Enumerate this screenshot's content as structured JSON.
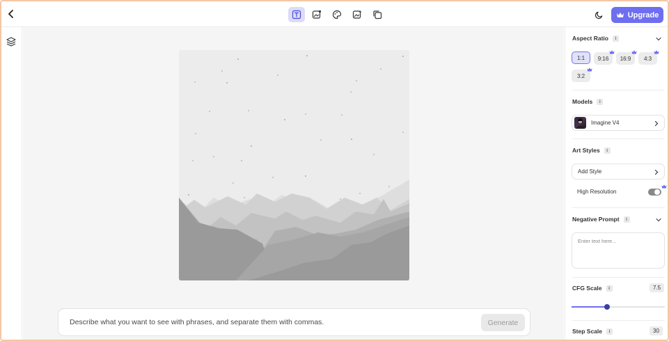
{
  "toolbar": {
    "tools": [
      {
        "icon": "text-to-image-icon",
        "active": true
      },
      {
        "icon": "image-edit-icon",
        "active": false
      },
      {
        "icon": "palette-icon",
        "active": false
      },
      {
        "icon": "image-sparkle-icon",
        "active": false
      },
      {
        "icon": "image-stack-icon",
        "active": false
      }
    ],
    "upgrade_label": "Upgrade",
    "accent_color": "#6e6ef0"
  },
  "prompt": {
    "placeholder": "Describe what you want to see with phrases, and separate them with commas.",
    "generate_label": "Generate"
  },
  "panel": {
    "aspect_ratio": {
      "title": "Aspect Ratio",
      "info": "i",
      "options": [
        {
          "label": "1:1",
          "selected": true,
          "premium": false
        },
        {
          "label": "9:16",
          "selected": false,
          "premium": true
        },
        {
          "label": "16:9",
          "selected": false,
          "premium": true
        },
        {
          "label": "4:3",
          "selected": false,
          "premium": true
        },
        {
          "label": "3:2",
          "selected": false,
          "premium": true
        }
      ]
    },
    "models": {
      "title": "Models",
      "info": "i",
      "selected": "Imagine V4"
    },
    "art_styles": {
      "title": "Art Styles",
      "info": "i",
      "add_label": "Add Style",
      "high_res_label": "High Resolution",
      "high_res_on": false,
      "high_res_premium": true
    },
    "negative_prompt": {
      "title": "Negative Prompt",
      "info": "i",
      "placeholder": "Enter text here..."
    },
    "cfg_scale": {
      "title": "CFG Scale",
      "info": "i",
      "value": "7.5",
      "fraction": 0.38
    },
    "step_scale": {
      "title": "Step Scale",
      "info": "i",
      "value": "30"
    }
  }
}
